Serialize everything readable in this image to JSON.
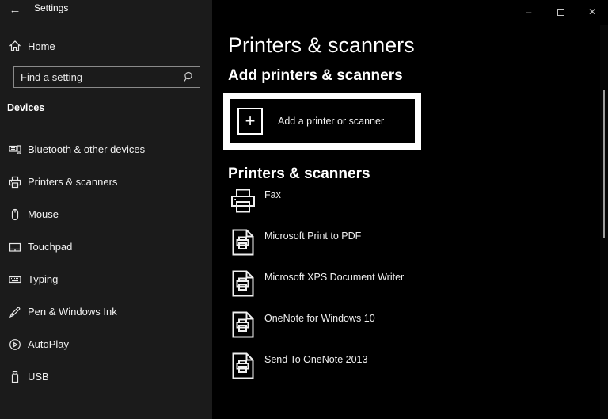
{
  "titlebar": {
    "title": "Settings",
    "back_glyph": "←",
    "minimize_glyph": "–",
    "close_glyph": "✕"
  },
  "sidebar": {
    "home_label": "Home",
    "search_placeholder": "Find a setting",
    "section_label": "Devices",
    "items": [
      {
        "label": "Bluetooth & other devices",
        "icon": "bluetooth-devices-icon"
      },
      {
        "label": "Printers & scanners",
        "icon": "printer-icon"
      },
      {
        "label": "Mouse",
        "icon": "mouse-icon"
      },
      {
        "label": "Touchpad",
        "icon": "touchpad-icon"
      },
      {
        "label": "Typing",
        "icon": "keyboard-icon"
      },
      {
        "label": "Pen & Windows Ink",
        "icon": "pen-icon"
      },
      {
        "label": "AutoPlay",
        "icon": "autoplay-icon"
      },
      {
        "label": "USB",
        "icon": "usb-icon"
      }
    ]
  },
  "main": {
    "title": "Printers & scanners",
    "add_section": {
      "heading": "Add printers & scanners",
      "button_label": "Add a printer or scanner",
      "plus_glyph": "+"
    },
    "list_section": {
      "heading": "Printers & scanners",
      "printers": [
        {
          "name": "Fax",
          "icon": "printer-icon"
        },
        {
          "name": "Microsoft Print to PDF",
          "icon": "print-file-icon"
        },
        {
          "name": "Microsoft XPS Document Writer",
          "icon": "print-file-icon"
        },
        {
          "name": "OneNote for Windows 10",
          "icon": "print-file-icon"
        },
        {
          "name": "Send To OneNote 2013",
          "icon": "print-file-icon"
        }
      ]
    }
  },
  "colors": {
    "sidebar_bg": "#1b1b1b",
    "main_bg": "#000000",
    "highlight_border": "#ffffff",
    "text": "#f2f2f2",
    "search_border": "#8a8a8a",
    "scrollbar_thumb": "#9e9e9e"
  }
}
